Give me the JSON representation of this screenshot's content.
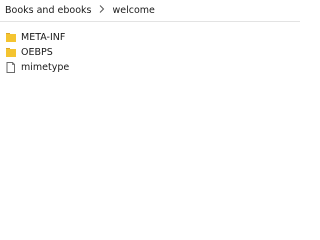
{
  "breadcrumb": {
    "items": [
      {
        "label": "Books and ebooks"
      },
      {
        "label": "welcome"
      }
    ],
    "separator_icon": "chevron-right-icon"
  },
  "files": [
    {
      "name": "META-INF",
      "icon": "folder-icon"
    },
    {
      "name": "OEBPS",
      "icon": "folder-icon"
    },
    {
      "name": "mimetype",
      "icon": "file-icon"
    }
  ],
  "colors": {
    "folder": "#f4c430",
    "folder_dark": "#dca62a",
    "file_outline": "#6b6b6b",
    "background": "#ffffff"
  }
}
